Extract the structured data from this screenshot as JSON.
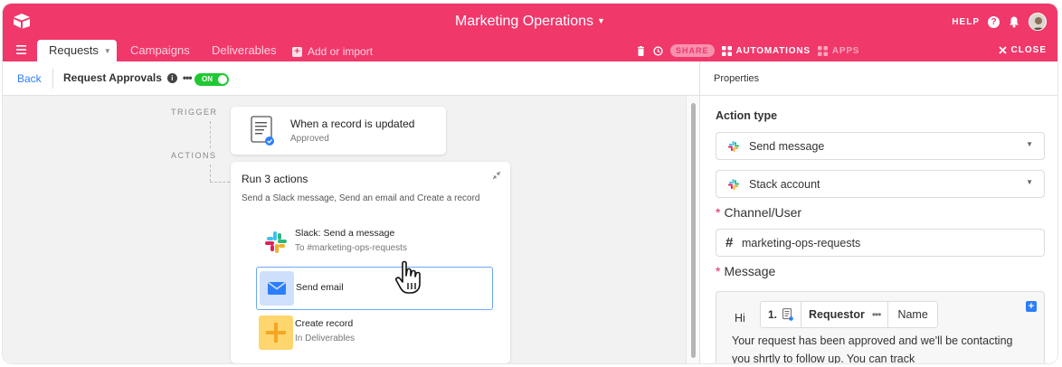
{
  "header": {
    "base_name": "Marketing Operations",
    "help_label": "HELP",
    "tabs": [
      {
        "label": "Requests"
      },
      {
        "label": "Campaigns"
      },
      {
        "label": "Deliverables"
      }
    ],
    "add_import_label": "Add or import",
    "share_label": "SHARE",
    "automations_label": "AUTOMATIONS",
    "apps_label": "APPS",
    "close_label": "CLOSE"
  },
  "subbar": {
    "back_label": "Back",
    "automation_name": "Request Approvals",
    "toggle_label": "ON"
  },
  "canvas": {
    "trigger_label": "TRIGGER",
    "actions_label": "ACTIONS",
    "trigger": {
      "title": "When a record is updated",
      "subtitle": "Approved"
    },
    "actions_group": {
      "title": "Run 3 actions",
      "description": "Send a Slack message, Send an email and Create a record",
      "items": [
        {
          "title": "Slack: Send a message",
          "subtitle": "To #marketing-ops-requests",
          "icon": "slack-icon"
        },
        {
          "title": "Send email",
          "subtitle": "",
          "icon": "email-icon",
          "color": "#cfe0fc"
        },
        {
          "title": "Create record",
          "subtitle": "In Deliverables",
          "icon": "plus-icon",
          "color": "#ffd66e"
        }
      ]
    }
  },
  "panel": {
    "title": "Properties",
    "action_type_label": "Action type",
    "action_type_value": "Send message",
    "account_value": "Stack account",
    "channel_label": "Channel/User",
    "channel_value": "marketing-ops-requests",
    "message_label": "Message",
    "message": {
      "greeting": "Hi",
      "token_step": "1.",
      "token_field": "Requestor",
      "token_subfield": "Name",
      "body": "Your request has been approved and we'll be contacting you shrtly to follow up. You can track"
    }
  },
  "colors": {
    "brand": "#f0386b",
    "accent": "#2d7ff9",
    "toggle_on": "#20c933"
  }
}
